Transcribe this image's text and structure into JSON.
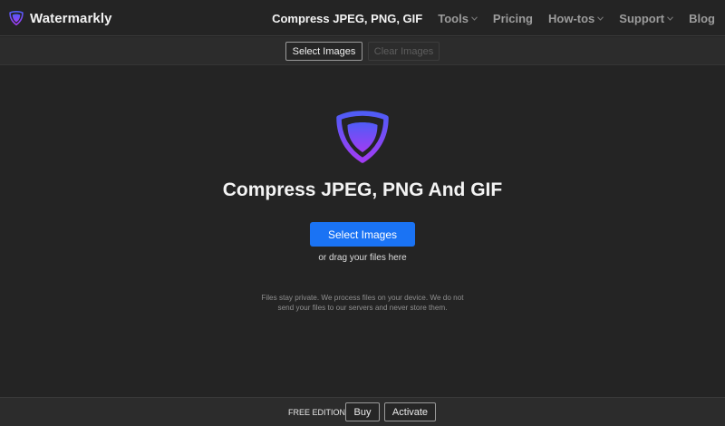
{
  "brand": {
    "name": "Watermarkly"
  },
  "nav": {
    "items": [
      {
        "label": "Compress JPEG, PNG, GIF",
        "active": true,
        "has_caret": false
      },
      {
        "label": "Tools",
        "active": false,
        "has_caret": true
      },
      {
        "label": "Pricing",
        "active": false,
        "has_caret": false
      },
      {
        "label": "How-tos",
        "active": false,
        "has_caret": true
      },
      {
        "label": "Support",
        "active": false,
        "has_caret": true
      },
      {
        "label": "Blog",
        "active": false,
        "has_caret": false
      }
    ]
  },
  "toolbar": {
    "select_label": "Select Images",
    "clear_label": "Clear Images"
  },
  "hero": {
    "title": "Compress JPEG, PNG And GIF",
    "button_label": "Select Images",
    "drag_hint": "or drag your files here",
    "privacy_note": "Files stay private. We process files on your device. We do not send your files to our servers and never store them."
  },
  "footer": {
    "edition_label": "FREE EDITION",
    "buy_label": "Buy",
    "activate_label": "Activate"
  },
  "colors": {
    "background": "#242424",
    "toolbar": "#2c2c2c",
    "accent_blue": "#1a73f4",
    "logo_gradient": [
      "#4f5cf6",
      "#a13cf4"
    ]
  },
  "icons": {
    "brand": "shield-icon",
    "hero": "shield-icon",
    "caret": "chevron-down-icon"
  }
}
